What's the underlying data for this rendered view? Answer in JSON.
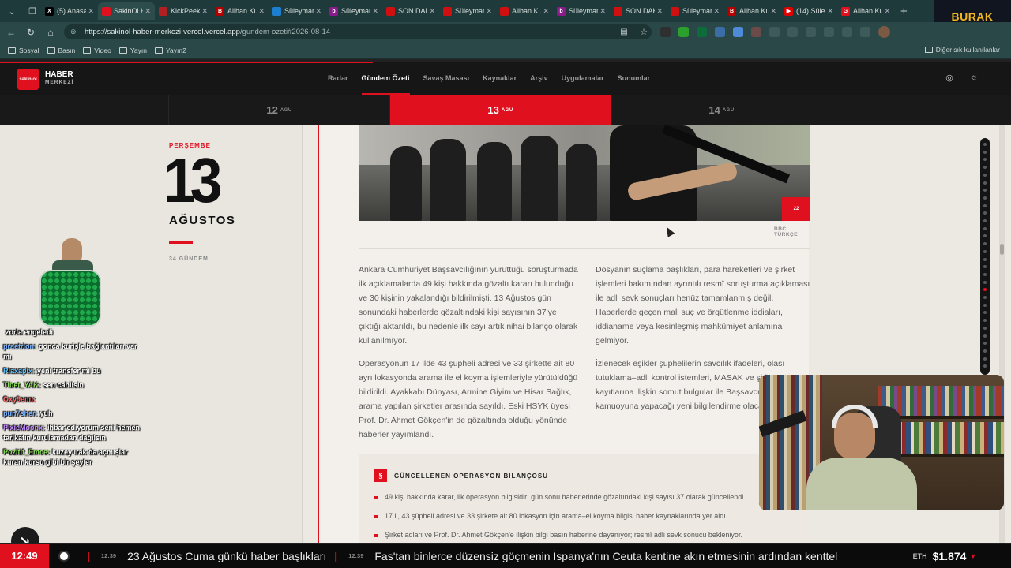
{
  "browser": {
    "tabs": [
      {
        "title": "(5) Anasayfa",
        "icon": "x-icon",
        "color": "#000000",
        "glyph": "X"
      },
      {
        "title": "SakinOl Haber",
        "icon": "site-icon",
        "color": "#e0101f",
        "glyph": "",
        "active": true
      },
      {
        "title": "KickPeek",
        "icon": "kick-icon",
        "color": "#b02020",
        "glyph": ""
      },
      {
        "title": "Alihan Kuzu",
        "icon": "bbc-icon",
        "color": "#b00000",
        "glyph": "B"
      },
      {
        "title": "Süleyman",
        "icon": "news-icon",
        "color": "#1c7ecf",
        "glyph": ""
      },
      {
        "title": "Süleyman",
        "icon": "b-icon",
        "color": "#8a1b8a",
        "glyph": "b"
      },
      {
        "title": "SON DAKİKA",
        "icon": "flag-icon",
        "color": "#d01010",
        "glyph": ""
      },
      {
        "title": "Süleyman",
        "icon": "flag-icon",
        "color": "#d01010",
        "glyph": ""
      },
      {
        "title": "Alihan Kuzu",
        "icon": "flag-icon",
        "color": "#d01010",
        "glyph": ""
      },
      {
        "title": "Süleyman",
        "icon": "b-icon",
        "color": "#8a1b8a",
        "glyph": "b"
      },
      {
        "title": "SON DAKİKA",
        "icon": "flag-icon",
        "color": "#d01010",
        "glyph": ""
      },
      {
        "title": "Süleyman",
        "icon": "flag-icon",
        "color": "#d01010",
        "glyph": ""
      },
      {
        "title": "Alihan Kuzu",
        "icon": "bbc-icon",
        "color": "#b00000",
        "glyph": "B"
      },
      {
        "title": "(14) Süleyman",
        "icon": "youtube-icon",
        "color": "#e00000",
        "glyph": "▶"
      },
      {
        "title": "Alihan Kuzu",
        "icon": "site-icon",
        "color": "#e0101f",
        "glyph": "G"
      }
    ],
    "url_host": "https://sakinol-haber-merkezi-vercel.vercel.app",
    "url_path": "/gundem-ozeti#2026-08-14",
    "bookmarks": [
      "Sosyal",
      "Basın",
      "Video",
      "Yayın",
      "Yayın2"
    ],
    "bookmarks_other": "Diğer sık kullanılanlar",
    "brand_overlay": "BURAK"
  },
  "site": {
    "logo_mark": "sakin ol",
    "logo_title": "HABER",
    "logo_sub": "MERKEZİ",
    "nav": [
      "Radar",
      "Gündem Özeti",
      "Savaş Masası",
      "Kaynaklar",
      "Arşiv",
      "Uygulamalar",
      "Sunumlar"
    ],
    "nav_active": "Gündem Özeti",
    "dates": [
      {
        "day": "12",
        "month": "AĞU"
      },
      {
        "day": "13",
        "month": "AĞU",
        "active": true
      },
      {
        "day": "14",
        "month": "AĞU"
      }
    ]
  },
  "day_panel": {
    "weekday": "PERŞEMBE",
    "day": "13",
    "month": "AĞUSTOS",
    "count": "34 GÜNDEM"
  },
  "article": {
    "photo_badge": "22",
    "credit": "BBC TÜRKÇE",
    "col1": [
      "Ankara Cumhuriyet Başsavcılığının yürüttüğü soruşturmada ilk açıklamalarda 49 kişi hakkında gözaltı kararı bulunduğu ve 30 kişinin yakalandığı bildirilmişti. 13 Ağustos gün sonundaki haberlerde gözaltındaki kişi sayısının 37'ye çıktığı aktarıldı, bu nedenle ilk sayı artık nihai bilanço olarak kullanılmıyor.",
      "Operasyonun 17 ilde 43 şüpheli adresi ve 33 şirkette ait 80 ayrı lokasyonda arama ile el koyma işlemleriyle yürütüldüğü bildirildi. Ayakkabı Dünyası, Armine Giyim ve Hisar Sağlık, arama yapılan şirketler arasında sayıldı. Eski HSYK üyesi Prof. Dr. Ahmet Gökçen'in de gözaltında olduğu yönünde haberler yayımlandı."
    ],
    "col2": [
      "Dosyanın suçlama başlıkları, para hareketleri ve şirket işlemleri bakımından ayrıntılı resmî soruşturma açıklaması ile adli sevk sonuçları henüz tamamlanmış değil. Haberlerde geçen mali suç ve örgütlenme iddiaları, iddianame veya kesinleşmiş mahkûmiyet anlamına gelmiyor.",
      "İzlenecek eşikler şüphelilerin savcılık ifadeleri, olası tutuklama–adli kontrol istemleri, MASAK ve şirket kayıtlarına ilişkin somut bulgular ile Başsavcılığın kamuoyuna yapacağı yeni bilgilendirme olacak."
    ],
    "summary_icon": "§",
    "summary_title": "GÜNCELLENEN OPERASYON BİLANÇOSU",
    "summary_items": [
      "49 kişi hakkında karar, ilk operasyon bilgisidir; gün sonu haberlerinde gözaltındaki kişi sayısı 37 olarak güncellendi.",
      "17 il, 43 şüpheli adresi ve 33 şirkete ait 80 lokasyon için arama–el koyma bilgisi haber kaynaklarında yer aldı.",
      "Şirket adları ve Prof. Dr. Ahmet Gökçen'e ilişkin bilgi basın haberine dayanıyor; resmî adli sevk sonucu bekleniyor."
    ]
  },
  "chat": [
    {
      "user": "",
      "text": "zorla engeledi",
      "color": "#ffffff"
    },
    {
      "user": "praetrion:",
      "text": "gonca kurişle bağlantıları var mı",
      "color": "#7ab4ff"
    },
    {
      "user": "Riaxapix:",
      "text": "yeni transfer mi bu",
      "color": "#5ec4ff"
    },
    {
      "user": "Tibet_YAK:",
      "text": "sen cahilsin",
      "color": "#8de05a"
    },
    {
      "user": "Oxy9enn:",
      "text": "",
      "color": "#ff6a6a"
    },
    {
      "user": "pun7sher:",
      "text": "yuh",
      "color": "#7ab4ff"
    },
    {
      "user": "PixieMoonx:",
      "text": "ihbar ediyorum seni hemen tarikatın kurulamadan dağılsın",
      "color": "#c58cff"
    },
    {
      "user": "Pozitif_Emce:",
      "text": "kuzey ırak da açmışlar kuran kursu gibi bir şeyler",
      "color": "#8de05a"
    }
  ],
  "ticker": {
    "clock": "12:49",
    "items": [
      {
        "time": "12:39",
        "text": "23 Ağustos Cuma günkü haber başlıkları"
      },
      {
        "time": "12:39",
        "text": "Fas'tan binlerce düzensiz göçmenin İspanya'nın Ceuta kentine akın etmesinin ardından kenttel"
      }
    ],
    "eth_symbol": "ETH",
    "eth_value": "$1.874",
    "eth_trend": "▼"
  },
  "colors": {
    "accent": "#e0101f",
    "dark": "#161616",
    "paper": "#f3f0eb"
  }
}
